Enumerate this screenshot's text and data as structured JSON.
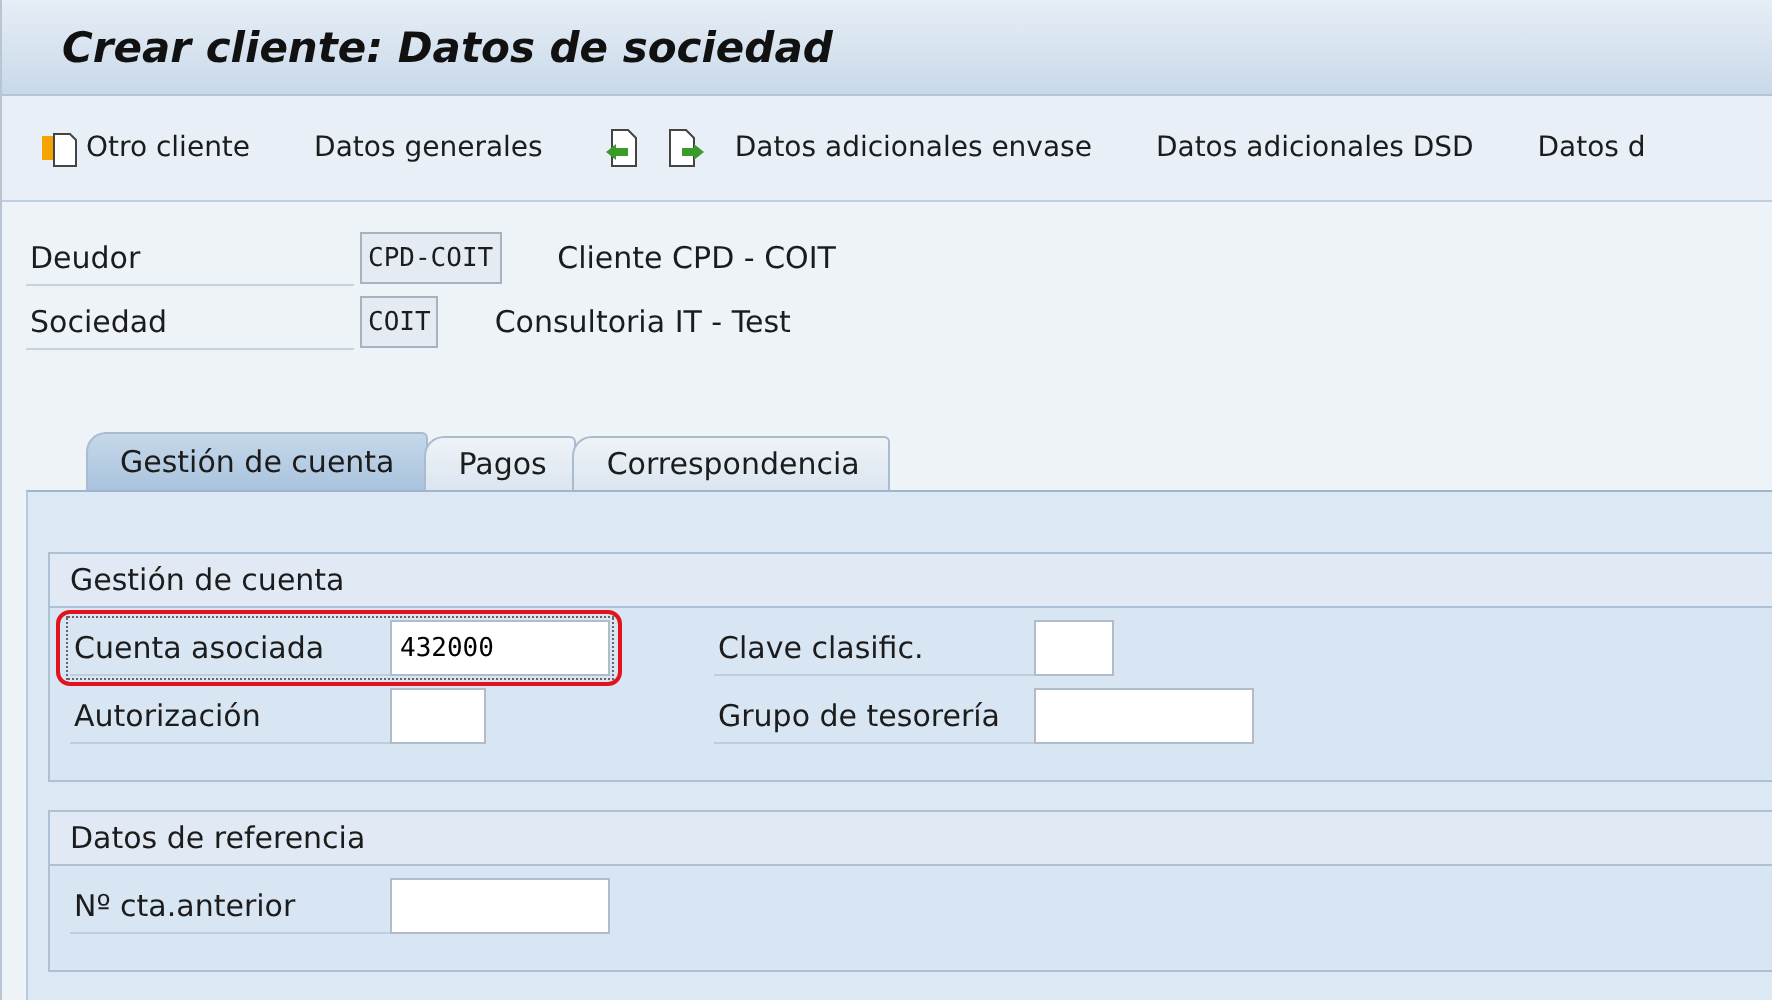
{
  "window": {
    "title": "Crear cliente: Datos de sociedad"
  },
  "toolbar": [
    {
      "kind": "new-entry",
      "label": "Otro cliente"
    },
    {
      "kind": "text",
      "label": "Datos generales"
    },
    {
      "kind": "prev-page"
    },
    {
      "kind": "next-page"
    },
    {
      "kind": "text",
      "label": "Datos adicionales envase"
    },
    {
      "kind": "text",
      "label": "Datos adicionales DSD"
    },
    {
      "kind": "text",
      "label": "Datos d"
    }
  ],
  "header": [
    {
      "label": "Deudor",
      "value": "CPD-COIT",
      "description": "Cliente CPD - COIT"
    },
    {
      "label": "Sociedad",
      "value": "COIT",
      "description": "Consultoria IT - Test"
    }
  ],
  "tabs": [
    {
      "label": "Gestión de cuenta",
      "selected": true
    },
    {
      "label": "Pagos",
      "selected": false
    },
    {
      "label": "Correspondencia",
      "selected": false
    }
  ],
  "groups": [
    {
      "title": "Gestión de cuenta",
      "columns": [
        [
          {
            "label": "Cuenta asociada",
            "value": "432000",
            "highlighted": true
          },
          {
            "label": "Autorización",
            "highlighted": false
          }
        ],
        [
          {
            "label": "Clave clasific.",
            "highlighted": false
          },
          {
            "label": "Grupo de tesorería",
            "highlighted": false
          }
        ]
      ]
    },
    {
      "title": "Datos de referencia",
      "columns": [
        [
          {
            "label": "Nº cta.anterior",
            "highlighted": false
          }
        ]
      ]
    }
  ]
}
